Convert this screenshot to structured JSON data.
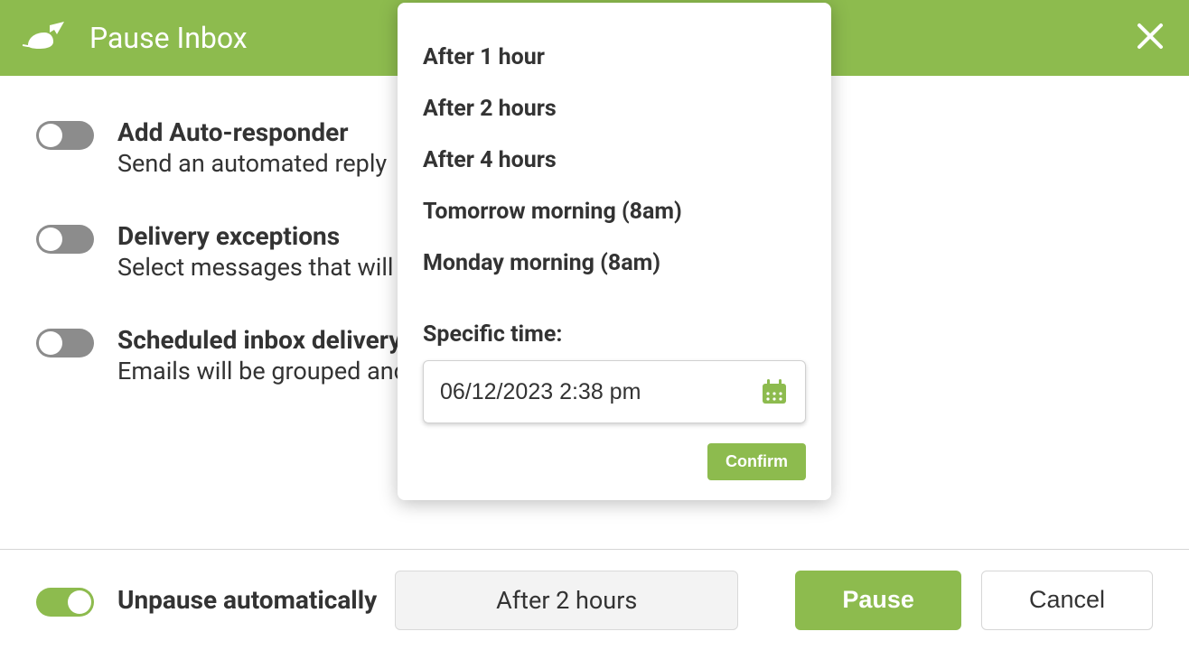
{
  "header": {
    "title": "Pause Inbox"
  },
  "settings": {
    "autoresponder": {
      "title": "Add Auto-responder",
      "desc": "Send an automated reply"
    },
    "delivery_exceptions": {
      "title": "Delivery exceptions",
      "desc": "Select messages that will still be delivered when inbox is paused"
    },
    "scheduled_delivery": {
      "title": "Scheduled inbox delivery",
      "desc": "Emails will be grouped and delivered a few times per day"
    }
  },
  "footer": {
    "unpause_label": "Unpause automatically",
    "time_selected": "After 2 hours",
    "pause_label": "Pause",
    "cancel_label": "Cancel"
  },
  "popover": {
    "options": [
      "After 1 hour",
      "After 2 hours",
      "After 4 hours",
      "Tomorrow morning (8am)",
      "Monday morning (8am)"
    ],
    "specific_time_label": "Specific time:",
    "datetime_value": "06/12/2023 2:38 pm",
    "confirm_label": "Confirm"
  },
  "colors": {
    "accent": "#8dbb4e"
  }
}
